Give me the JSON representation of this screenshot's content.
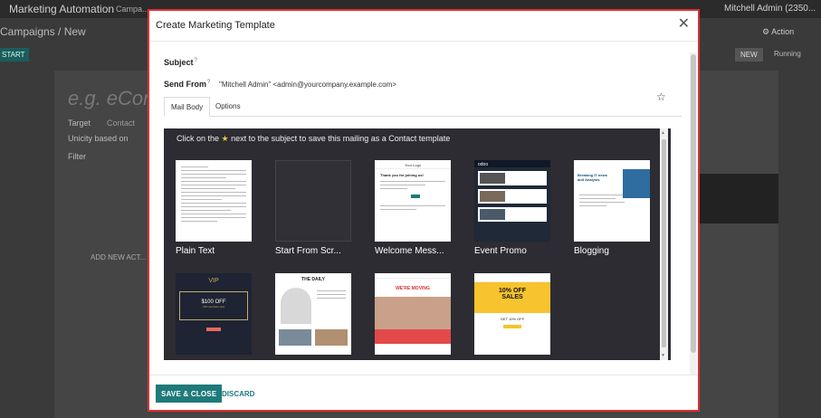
{
  "background": {
    "app_name": "Marketing Automation",
    "menu": "Campa...",
    "user": "Mitchell Admin (2350...",
    "breadcrumb": "Campaigns / New",
    "start": "START",
    "action": "⚙ Action",
    "status_new": "NEW",
    "status_running": "Running",
    "name_placeholder": "e.g. eCom...",
    "target_label": "Target",
    "target_value": "Contact",
    "unicity_label": "Unicity based on",
    "filter_label": "Filter",
    "add_new": "ADD NEW ACT..."
  },
  "modal": {
    "title": "Create Marketing Template",
    "subject_label": "Subject",
    "send_from_label": "Send From",
    "help_mark": "?",
    "send_from_value": "\"Mitchell Admin\" <admin@yourcompany.example.com>",
    "tabs": [
      "Mail Body",
      "Options"
    ],
    "hint_prefix": "Click on the",
    "hint_suffix": "next to the subject to save this mailing as a Contact template",
    "templates": [
      {
        "label": "Plain Text"
      },
      {
        "label": "Start From Scr..."
      },
      {
        "label": "Welcome Mess..."
      },
      {
        "label": "Event Promo"
      },
      {
        "label": "Blogging"
      },
      {
        "label": ""
      },
      {
        "label": ""
      },
      {
        "label": ""
      },
      {
        "label": ""
      }
    ],
    "thumb_text": {
      "welcome_logo": "Your Logo",
      "welcome_heading": "Thank you for joining us!",
      "vip": "VIP",
      "vip_offer": "$100 OFF",
      "vip_sub": "VIP members only",
      "daily": "THE DAILY",
      "moving": "WE'RE MOVING",
      "sale_line1": "10% OFF",
      "sale_line2": "SALES",
      "sale_sub": "GET 10% OFF",
      "blog_title": "Breaking IT news and Analysis",
      "event_logo": "odoo"
    },
    "save_button": "SAVE & CLOSE",
    "discard_button": "DISCARD",
    "colors": {
      "accent": "#1f7a7a",
      "highlight_border": "#e03131",
      "editor_bg": "#2c2c32",
      "star": "#f2c744"
    }
  }
}
